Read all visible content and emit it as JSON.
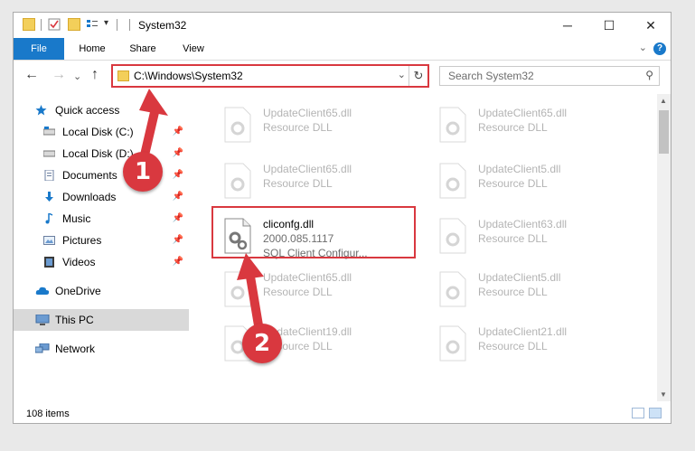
{
  "window": {
    "title": "System32",
    "minimize": "─",
    "maximize": "☐",
    "close": "✕"
  },
  "ribbon": {
    "tabs": [
      "File",
      "Home",
      "Share",
      "View"
    ],
    "expand": "⌄",
    "help": "?"
  },
  "nav": {
    "back": "←",
    "forward": "→",
    "recent": "⌄",
    "up": "↑",
    "address": "C:\\Windows\\System32",
    "address_chevron": "⌄",
    "refresh": "↻",
    "search_placeholder": "Search System32",
    "search_icon": "⚲"
  },
  "sidebar": {
    "quick_access": "Quick access",
    "items": [
      {
        "label": "Local Disk (C:)",
        "icon": "drive-icon",
        "pinned": true
      },
      {
        "label": "Local Disk (D:)",
        "icon": "drive-icon",
        "pinned": true
      },
      {
        "label": "Documents",
        "icon": "documents-icon",
        "pinned": true
      },
      {
        "label": "Downloads",
        "icon": "download-icon",
        "pinned": true
      },
      {
        "label": "Music",
        "icon": "music-icon",
        "pinned": true
      },
      {
        "label": "Pictures",
        "icon": "pictures-icon",
        "pinned": true
      },
      {
        "label": "Videos",
        "icon": "videos-icon",
        "pinned": true
      }
    ],
    "onedrive": "OneDrive",
    "this_pc": "This PC",
    "network": "Network",
    "pin_glyph": "📌"
  },
  "files": {
    "left": [
      {
        "name": "UpdateClient65.dll",
        "desc": "Resource DLL"
      },
      {
        "name": "UpdateClient65.dll",
        "desc": "Resource DLL"
      },
      {
        "name": "cliconfg.dll",
        "version": "2000.085.1117",
        "desc": "SQL Client Configur..."
      },
      {
        "name": "UpdateClient65.dll",
        "desc": "Resource DLL"
      },
      {
        "name": "UpdateClient19.dll",
        "desc": "Resource DLL"
      }
    ],
    "right": [
      {
        "name": "UpdateClient65.dll",
        "desc": "Resource DLL"
      },
      {
        "name": "UpdateClient5.dll",
        "desc": "Resource DLL"
      },
      {
        "name": "UpdateClient63.dll",
        "desc": "Resource DLL"
      },
      {
        "name": "UpdateClient5.dll",
        "desc": "Resource DLL"
      },
      {
        "name": "UpdateClient21.dll",
        "desc": "Resource DLL"
      }
    ]
  },
  "status": {
    "count": "108 items"
  },
  "callouts": [
    "1",
    "2"
  ],
  "colors": {
    "accent": "#1979ca",
    "highlight": "#d9383f",
    "selected_bg": "#d9d9d9"
  }
}
